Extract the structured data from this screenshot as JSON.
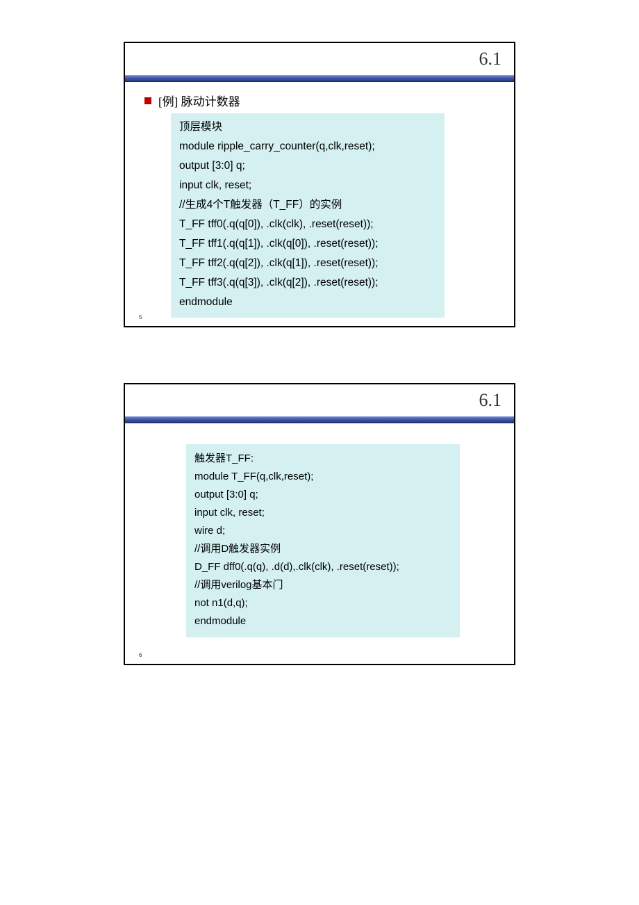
{
  "slide1": {
    "section": "6.1",
    "bullet": "[例] 脉动计数器",
    "code": [
      "顶层模块",
      "module ripple_carry_counter(q,clk,reset);",
      "output [3:0] q;",
      "input clk, reset;",
      "//生成4个T触发器（T_FF）的实例",
      "T_FF tff0(.q(q[0]), .clk(clk), .reset(reset));",
      "T_FF tff1(.q(q[1]), .clk(q[0]), .reset(reset));",
      "T_FF tff2(.q(q[2]), .clk(q[1]), .reset(reset));",
      "T_FF tff3(.q(q[3]), .clk(q[2]), .reset(reset));",
      "endmodule"
    ],
    "pagenum": "5"
  },
  "slide2": {
    "section": "6.1",
    "code": [
      "触发器T_FF:",
      "module T_FF(q,clk,reset);",
      "output [3:0] q;",
      "input clk, reset;",
      "wire d;",
      "//调用D触发器实例",
      "D_FF dff0(.q(q), .d(d),.clk(clk), .reset(reset));",
      "//调用verilog基本门",
      "not n1(d,q);",
      "endmodule"
    ],
    "pagenum": "6"
  }
}
